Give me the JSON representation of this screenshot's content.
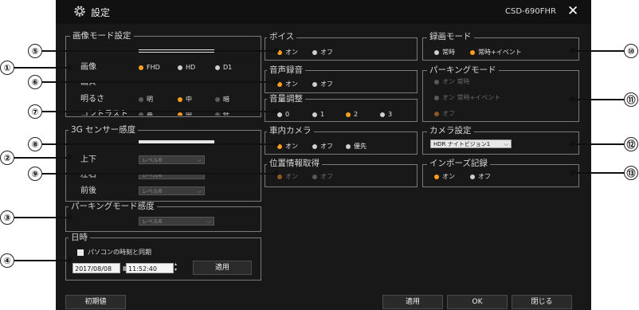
{
  "window": {
    "title": "設定",
    "model": "CSD-690FHR",
    "close_symbol": "✕",
    "gear_symbol": "⚙"
  },
  "image_mode": {
    "title": "画像モード設定",
    "rows": [
      {
        "label": "画像",
        "options": [
          "FHD",
          "HD",
          "D1"
        ],
        "selected": "FHD"
      },
      {
        "label": "画質",
        "options": [
          "高",
          "中",
          "低"
        ],
        "selected": "中"
      },
      {
        "label": "明るさ",
        "options": [
          "明",
          "中",
          "暗"
        ],
        "selected": "中"
      },
      {
        "label": "コントラスト",
        "options": [
          "高",
          "中",
          "低"
        ],
        "selected": "中"
      }
    ]
  },
  "g_sensor": {
    "title": "3G センサー感度",
    "rows": [
      {
        "label": "上下",
        "value": "レベル6"
      },
      {
        "label": "左右",
        "value": "レベル6"
      },
      {
        "label": "前後",
        "value": "レベル6"
      }
    ]
  },
  "parking_sensitivity": {
    "title": "パーキングモード感度",
    "value": "レベル6"
  },
  "datetime": {
    "title": "日時",
    "sync_label": "パソコンの時刻と同期",
    "date": "2017/08/08",
    "time": "11:52:40",
    "apply": "適用"
  },
  "voice": {
    "title": "ボイス",
    "options": [
      "オン",
      "オフ"
    ],
    "selected": "オン"
  },
  "audio_rec": {
    "title": "音声録音",
    "options": [
      "オン",
      "オフ"
    ],
    "selected": "オン"
  },
  "volume": {
    "title": "音量調整",
    "options": [
      "0",
      "1",
      "2",
      "3"
    ],
    "selected": "2"
  },
  "cabin_cam": {
    "title": "車内カメラ",
    "options": [
      "オン",
      "オフ",
      "優先"
    ],
    "selected": "オン"
  },
  "gps": {
    "title": "位置情報取得",
    "options": [
      "オン",
      "オフ"
    ],
    "selected": "オン"
  },
  "rec_mode": {
    "title": "録画モード",
    "options": [
      "常時",
      "常時+イベント"
    ],
    "selected": "常時+イベント"
  },
  "parking_mode": {
    "title": "パーキングモード",
    "options": [
      "オン 常時",
      "オン 常時+イベント",
      "オフ"
    ],
    "selected": "オフ"
  },
  "camera_settings": {
    "title": "カメラ設定",
    "value": "HDR ナイトビジョン1"
  },
  "impose": {
    "title": "インポーズ記録",
    "options": [
      "オン",
      "オフ"
    ],
    "selected": "オン"
  },
  "footer": {
    "default": "初期値",
    "apply": "適用",
    "ok": "OK",
    "close": "閉じる"
  },
  "callouts": [
    "①",
    "②",
    "③",
    "④",
    "⑤",
    "⑥",
    "⑦",
    "⑧",
    "⑨",
    "⑩",
    "⑪",
    "⑫",
    "⑬"
  ]
}
